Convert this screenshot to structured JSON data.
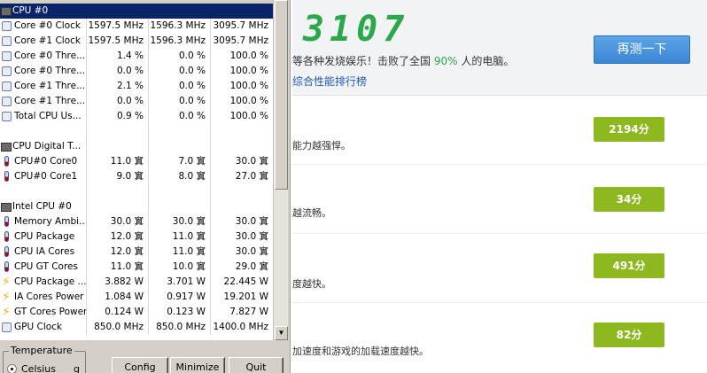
{
  "sensor_monitor": {
    "rows": [
      {
        "type": "header",
        "icon": "cpu-chip-icon",
        "name": "CPU #0",
        "v1": "",
        "v2": "",
        "v3": "",
        "selected": true
      },
      {
        "type": "sensor",
        "icon": "gauge-icon",
        "name": "Core #0 Clock",
        "v1": "1597.5 MHz",
        "v2": "1596.3 MHz",
        "v3": "3095.7 MHz"
      },
      {
        "type": "sensor",
        "icon": "gauge-icon",
        "name": "Core #1 Clock",
        "v1": "1597.5 MHz",
        "v2": "1596.3 MHz",
        "v3": "3095.7 MHz"
      },
      {
        "type": "sensor",
        "icon": "gauge-icon",
        "name": "Core #0 Thre...",
        "v1": "1.4 %",
        "v2": "0.0 %",
        "v3": "100.0 %"
      },
      {
        "type": "sensor",
        "icon": "gauge-icon",
        "name": "Core #0 Thre...",
        "v1": "0.0 %",
        "v2": "0.0 %",
        "v3": "100.0 %"
      },
      {
        "type": "sensor",
        "icon": "gauge-icon",
        "name": "Core #1 Thre...",
        "v1": "2.1 %",
        "v2": "0.0 %",
        "v3": "100.0 %"
      },
      {
        "type": "sensor",
        "icon": "gauge-icon",
        "name": "Core #1 Thre...",
        "v1": "0.0 %",
        "v2": "0.0 %",
        "v3": "100.0 %"
      },
      {
        "type": "sensor",
        "icon": "gauge-icon",
        "name": "Total CPU Us...",
        "v1": "0.9 %",
        "v2": "0.0 %",
        "v3": "100.0 %"
      },
      {
        "type": "blank",
        "icon": "",
        "name": "",
        "v1": "",
        "v2": "",
        "v3": ""
      },
      {
        "type": "header",
        "icon": "cpu-chip-icon",
        "name": "CPU Digital T...",
        "v1": "",
        "v2": "",
        "v3": ""
      },
      {
        "type": "sensor",
        "icon": "thermometer-icon",
        "name": "CPU#0 Core0",
        "v1": "11.0 窴",
        "v2": "7.0 窴",
        "v3": "30.0 窴"
      },
      {
        "type": "sensor",
        "icon": "thermometer-icon",
        "name": "CPU#0 Core1",
        "v1": "9.0 窴",
        "v2": "8.0 窴",
        "v3": "27.0 窴"
      },
      {
        "type": "blank",
        "icon": "",
        "name": "",
        "v1": "",
        "v2": "",
        "v3": ""
      },
      {
        "type": "header",
        "icon": "cpu-chip-icon",
        "name": "Intel CPU #0",
        "v1": "",
        "v2": "",
        "v3": ""
      },
      {
        "type": "sensor",
        "icon": "thermometer-icon",
        "name": "Memory Ambi...",
        "v1": "30.0 窴",
        "v2": "30.0 窴",
        "v3": "30.0 窴"
      },
      {
        "type": "sensor",
        "icon": "thermometer-icon",
        "name": "CPU Package",
        "v1": "12.0 窴",
        "v2": "11.0 窴",
        "v3": "30.0 窴"
      },
      {
        "type": "sensor",
        "icon": "thermometer-icon",
        "name": "CPU IA Cores",
        "v1": "12.0 窴",
        "v2": "11.0 窴",
        "v3": "30.0 窴"
      },
      {
        "type": "sensor",
        "icon": "thermometer-icon",
        "name": "CPU GT Cores",
        "v1": "11.0 窴",
        "v2": "10.0 窴",
        "v3": "29.0 窴"
      },
      {
        "type": "sensor",
        "icon": "bolt-icon",
        "name": "CPU Package ...",
        "v1": "3.882 W",
        "v2": "3.701 W",
        "v3": "22.445 W"
      },
      {
        "type": "sensor",
        "icon": "bolt-icon",
        "name": "IA Cores Power",
        "v1": "1.084 W",
        "v2": "0.917 W",
        "v3": "19.201 W"
      },
      {
        "type": "sensor",
        "icon": "bolt-icon",
        "name": "GT Cores Power",
        "v1": "0.124 W",
        "v2": "0.123 W",
        "v3": "7.827 W"
      },
      {
        "type": "sensor",
        "icon": "gauge-icon",
        "name": "GPU Clock",
        "v1": "850.0 MHz",
        "v2": "850.0 MHz",
        "v3": "1400.0 MHz"
      }
    ],
    "temperature_group": {
      "legend": "Temperature",
      "option_label": "Celsius",
      "option_suffix": "g"
    },
    "buttons": [
      {
        "label": "Config",
        "name": "config-button"
      },
      {
        "label": "Minimize",
        "name": "minimize-button"
      },
      {
        "label": "Quit",
        "name": "quit-button"
      }
    ]
  },
  "benchmark": {
    "total_score": "3107",
    "summary_prefix": "等各种发烧娱乐！击败了全国 ",
    "summary_percent": "90%",
    "summary_suffix": " 人的电脑。",
    "rank_link": "综合性能排行榜",
    "retest_button": "再测一下",
    "items": [
      {
        "desc": "能力越强悍。",
        "score": "2194分"
      },
      {
        "desc": "越流畅。",
        "score": "34分"
      },
      {
        "desc": "度越快。",
        "score": "491分"
      },
      {
        "desc": "加速度和游戏的加载速度越快。",
        "score": "82分"
      }
    ]
  }
}
